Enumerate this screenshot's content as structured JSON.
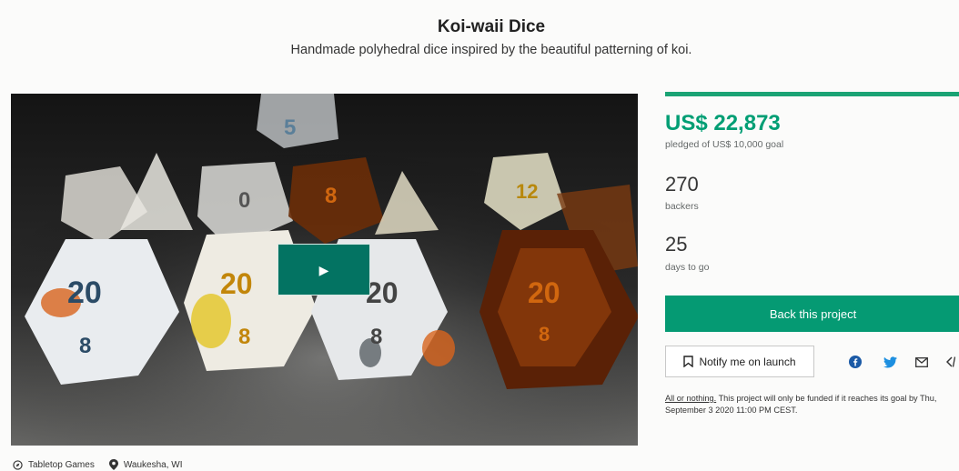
{
  "project": {
    "title": "Koi-waii Dice",
    "subtitle": "Handmade polyhedral dice inspired by the beautiful patterning of koi.",
    "category": "Tabletop Games",
    "location": "Waukesha, WI"
  },
  "video": {
    "play_icon": "play-icon"
  },
  "stats": {
    "pledged": "US$ 22,873",
    "pledged_goal": "pledged of US$ 10,000 goal",
    "funded_fraction": 1.0,
    "backers_count": "270",
    "backers_label": "backers",
    "days_count": "25",
    "days_label": "days to go"
  },
  "actions": {
    "back_label": "Back this project",
    "notify_label": "Notify me on launch"
  },
  "share_icons": [
    "facebook-icon",
    "twitter-icon",
    "email-icon",
    "embed-icon"
  ],
  "terms": {
    "link": "All or nothing.",
    "text": " This project will only be funded if it reaches its goal by Thu, September 3 2020 11:00 PM CEST."
  },
  "colors": {
    "accent": "#059a73",
    "pledged": "#009e74"
  }
}
